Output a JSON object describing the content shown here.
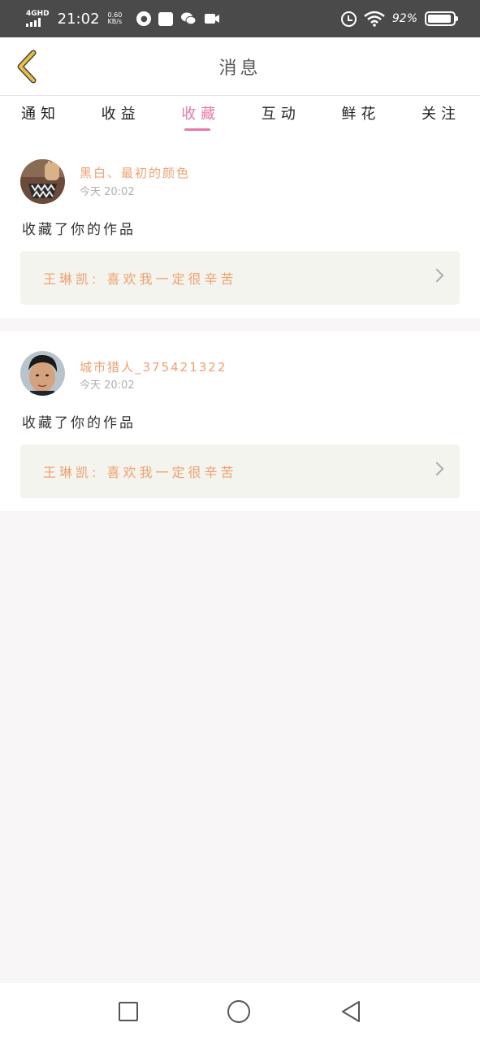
{
  "status_bar": {
    "network": "4GHD",
    "time": "21:02",
    "speed_value": "0.60",
    "speed_unit": "KB/s",
    "battery_text": "92%",
    "battery_level": 0.92
  },
  "header": {
    "title": "消息"
  },
  "tabs": [
    {
      "label": "通知"
    },
    {
      "label": "收益"
    },
    {
      "label": "收藏",
      "active": true
    },
    {
      "label": "互动"
    },
    {
      "label": "鲜花"
    },
    {
      "label": "关注"
    }
  ],
  "messages": [
    {
      "username": "黑白、最初的颜色",
      "time": "今天 20:02",
      "action": "收藏了你的作品",
      "work": "王琳凯: 喜欢我一定很辛苦"
    },
    {
      "username": "城市猎人_375421322",
      "time": "今天 20:02",
      "action": "收藏了你的作品",
      "work": "王琳凯: 喜欢我一定很辛苦"
    }
  ],
  "colors": {
    "accent": "#e878a8",
    "username": "#f0a070",
    "back_arrow": "#e8c040"
  }
}
